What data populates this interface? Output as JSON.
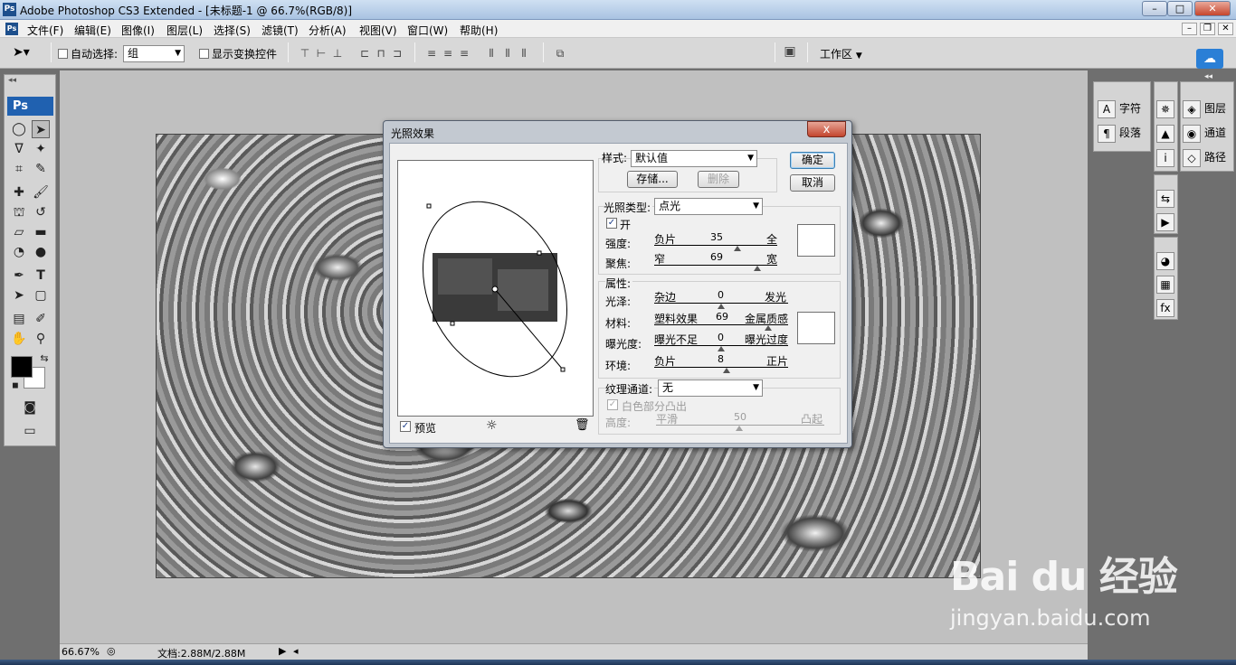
{
  "window": {
    "title": "Adobe Photoshop CS3 Extended - [未标题-1 @ 66.7%(RGB/8)]",
    "app_icon": "ps-logo"
  },
  "menu": [
    "文件(F)",
    "编辑(E)",
    "图像(I)",
    "图层(L)",
    "选择(S)",
    "滤镜(T)",
    "分析(A)",
    "视图(V)",
    "窗口(W)",
    "帮助(H)"
  ],
  "options": {
    "auto_select_label": "自动选择:",
    "auto_select_value": "组",
    "show_transform_label": "显示变换控件",
    "workspace_label": "工作区"
  },
  "toolbox": {
    "badge": "Ps"
  },
  "status": {
    "zoom": "66.67%",
    "doc_info": "文档:2.88M/2.88M"
  },
  "dock": {
    "col1": [
      "字符",
      "段落"
    ],
    "col3": [
      "图层",
      "通道",
      "路径"
    ]
  },
  "dialog": {
    "title": "光照效果",
    "close": "x",
    "style_label": "样式:",
    "style_value": "默认值",
    "save_btn": "存储...",
    "delete_btn": "删除",
    "ok_btn": "确定",
    "cancel_btn": "取消",
    "light_type_label": "光照类型:",
    "light_type_value": "点光",
    "on_label": "开",
    "intensity": {
      "label": "强度:",
      "left": "负片",
      "value": "35",
      "right": "全"
    },
    "focus": {
      "label": "聚焦:",
      "left": "窄",
      "value": "69",
      "right": "宽"
    },
    "properties_label": "属性:",
    "gloss": {
      "label": "光泽:",
      "left": "杂边",
      "value": "0",
      "right": "发光"
    },
    "material": {
      "label": "材料:",
      "left": "塑料效果",
      "value": "69",
      "right": "金属质感"
    },
    "exposure": {
      "label": "曝光度:",
      "left": "曝光不足",
      "value": "0",
      "right": "曝光过度"
    },
    "ambience": {
      "label": "环境:",
      "left": "负片",
      "value": "8",
      "right": "正片"
    },
    "texture_label": "纹理通道:",
    "texture_value": "无",
    "white_high_label": "白色部分凸出",
    "height": {
      "label": "高度:",
      "left": "平滑",
      "value": "50",
      "right": "凸起"
    },
    "preview_label": "预览"
  },
  "watermark": {
    "main": "Bai du 经验",
    "url": "jingyan.baidu.com"
  }
}
